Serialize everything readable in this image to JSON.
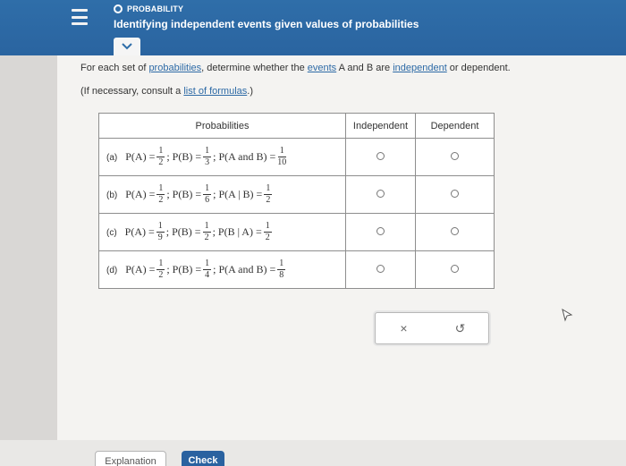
{
  "header": {
    "topic": "PROBABILITY",
    "title": "Identifying independent events given values of probabilities"
  },
  "instruction": {
    "prefix": "For each set of ",
    "probabilities_link": "probabilities",
    "middle": ", determine whether the ",
    "events_link": "events",
    "vars": " A and B are ",
    "independent_link": "independent",
    "suffix": " or dependent."
  },
  "hint": {
    "prefix": "(If necessary, consult a ",
    "link": "list of formulas",
    "suffix": ".)"
  },
  "table": {
    "headers": [
      "Probabilities",
      "Independent",
      "Dependent"
    ],
    "rows": [
      {
        "tag": "(a)",
        "p1_lhs": "P(A) =",
        "p1_num": "1",
        "p1_den": "2",
        "p2_lhs": "; P(B) =",
        "p2_num": "1",
        "p2_den": "3",
        "p3_lhs": "; P(A and B) =",
        "p3_num": "1",
        "p3_den": "10"
      },
      {
        "tag": "(b)",
        "p1_lhs": "P(A) =",
        "p1_num": "1",
        "p1_den": "2",
        "p2_lhs": "; P(B) =",
        "p2_num": "1",
        "p2_den": "6",
        "p3_lhs": "; P(A | B) =",
        "p3_num": "1",
        "p3_den": "2"
      },
      {
        "tag": "(c)",
        "p1_lhs": "P(A) =",
        "p1_num": "1",
        "p1_den": "9",
        "p2_lhs": "; P(B) =",
        "p2_num": "1",
        "p2_den": "2",
        "p3_lhs": "; P(B | A) =",
        "p3_num": "1",
        "p3_den": "2"
      },
      {
        "tag": "(d)",
        "p1_lhs": "P(A) =",
        "p1_num": "1",
        "p1_den": "2",
        "p2_lhs": "; P(B) =",
        "p2_num": "1",
        "p2_den": "4",
        "p3_lhs": "; P(A and B) =",
        "p3_num": "1",
        "p3_den": "8"
      }
    ]
  },
  "actions": {
    "clear_symbol": "×",
    "undo_symbol": "↺"
  },
  "footer": {
    "explanation_label": "Explanation",
    "check_label": "Check"
  },
  "colors": {
    "header_blue": "#2f6ea9",
    "link_blue": "#2d6aa6",
    "check_button": "#2a62a0"
  }
}
